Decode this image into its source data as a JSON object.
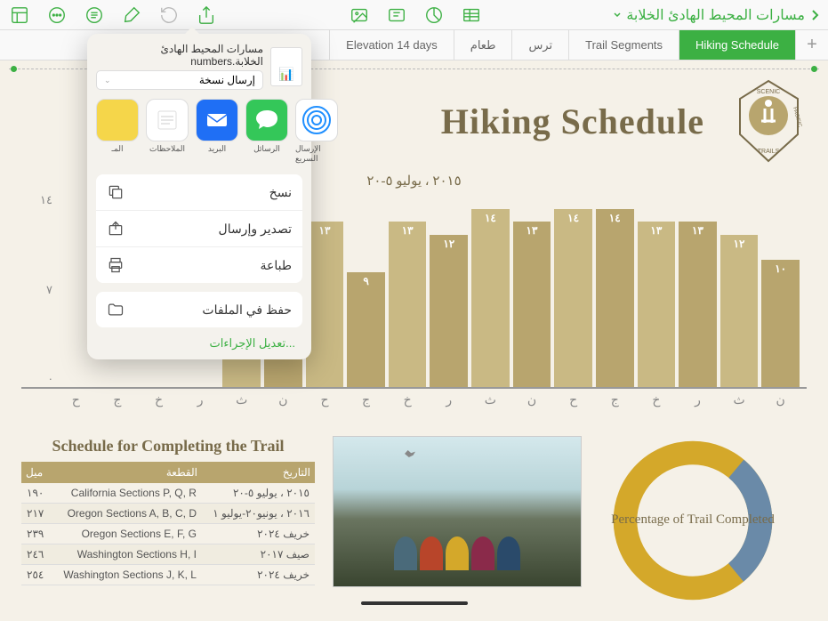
{
  "toolbar": {
    "doc_title": "مسارات المحيط الهادئ الخلابة"
  },
  "tabs": [
    {
      "label": "Elevation 14 days",
      "active": false
    },
    {
      "label": "طعام",
      "active": false
    },
    {
      "label": "ترس",
      "active": false
    },
    {
      "label": "Trail Segments",
      "active": false
    },
    {
      "label": "Hiking Schedule",
      "active": true
    }
  ],
  "page_title": "Hiking Schedule",
  "logo_text": {
    "top": "SCENIC",
    "right": "PACIFIC",
    "bottom": "TRAILS"
  },
  "chart_data": {
    "type": "bar",
    "title": "٢٠١٥ ، يوليو ٥-٢٠",
    "categories": [
      "ح",
      "ج",
      "خ",
      "ر",
      "ث",
      "ن",
      "ح",
      "ج",
      "خ",
      "ر",
      "ث",
      "ن",
      "ح",
      "ج",
      "خ",
      "ر",
      "ث",
      "ن"
    ],
    "values": [
      null,
      null,
      null,
      null,
      14,
      13,
      13,
      9,
      13,
      12,
      14,
      13,
      14,
      14,
      13,
      13,
      12,
      10
    ],
    "ylabel": "",
    "y_ticks": [
      "١٤",
      "٧",
      "·"
    ],
    "ylim": [
      0,
      14
    ]
  },
  "schedule": {
    "title": "Schedule for Completing the Trail",
    "headers": [
      "ميل",
      "القطعة",
      "التاريخ"
    ],
    "rows": [
      {
        "miles": "١٩٠",
        "segment": "California Sections P, Q, R",
        "date": "٢٠١٥ ، يوليو ٥-٢٠"
      },
      {
        "miles": "٢١٧",
        "segment": "Oregon Sections A, B, C, D",
        "date": "٢٠١٦ ، يونيو٢٠-يوليو ١"
      },
      {
        "miles": "٢٣٩",
        "segment": "Oregon Sections E, F, G",
        "date": "خريف ٢٠٢٤"
      },
      {
        "miles": "٢٤٦",
        "segment": "Washington Sections H, I",
        "date": "صيف ٢٠١٧"
      },
      {
        "miles": "٢٥٤",
        "segment": "Washington Sections J, K, L",
        "date": "خريف ٢٠٢٤"
      }
    ]
  },
  "donut": {
    "text": "Percentage of Trail Completed"
  },
  "popover": {
    "filename": "مسارات المحيط الهادئ الخلابة.numbers",
    "send_copy": "إرسال نسخة",
    "share": [
      {
        "label": "الإرسال السريع",
        "key": "airdrop"
      },
      {
        "label": "الرسائل",
        "key": "messages"
      },
      {
        "label": "البريد",
        "key": "mail"
      },
      {
        "label": "الملاحظات",
        "key": "notes"
      },
      {
        "label": "المـ",
        "key": "more"
      }
    ],
    "actions": [
      {
        "label": "نسخ",
        "icon": "copy"
      },
      {
        "label": "تصدير وإرسال",
        "icon": "export"
      },
      {
        "label": "طباعة",
        "icon": "print"
      }
    ],
    "actions2": [
      {
        "label": "حفظ في الملفات",
        "icon": "folder"
      }
    ],
    "edit": "تعديل الإجراءات..."
  }
}
